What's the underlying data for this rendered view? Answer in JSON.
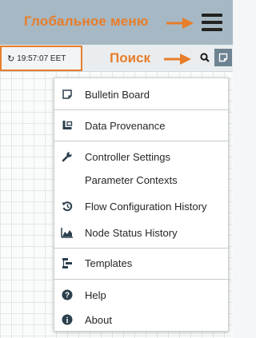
{
  "annotations": {
    "global_menu": "Глобальное меню",
    "search": "Поиск"
  },
  "status": {
    "time": "19:57:07 EET"
  },
  "menu": {
    "items": [
      {
        "label": "Bulletin Board",
        "icon": "bulletin-board-icon"
      },
      {
        "label": "Data Provenance",
        "icon": "data-provenance-icon"
      },
      {
        "label": "Controller Settings",
        "icon": "wrench-icon"
      },
      {
        "label": "Parameter Contexts",
        "icon": ""
      },
      {
        "label": "Flow Configuration History",
        "icon": "history-icon"
      },
      {
        "label": "Node Status History",
        "icon": "area-chart-icon"
      },
      {
        "label": "Templates",
        "icon": "templates-icon"
      },
      {
        "label": "Help",
        "icon": "help-icon"
      },
      {
        "label": "About",
        "icon": "info-icon"
      }
    ]
  },
  "colors": {
    "annotation": "#e87d2a",
    "topbar": "#a6b8c3",
    "menu_icon": "#2b3f4c"
  }
}
